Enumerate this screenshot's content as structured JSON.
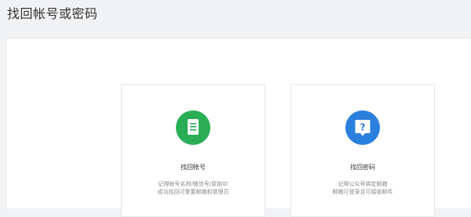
{
  "header": {
    "title": "找回帐号或密码"
  },
  "cards": [
    {
      "title": "找回帐号",
      "desc_line1": "记得帐号名称/微信号/原始ID",
      "desc_line2": "成功找回可重置邮箱和管理员",
      "icon": "document-icon",
      "color": "#2aae55"
    },
    {
      "title": "找回密码",
      "desc_line1": "记得公众号绑定邮箱",
      "desc_line2": "邮箱可登录且可接收邮件",
      "icon": "question-chat-icon",
      "color": "#2b7fdd"
    }
  ]
}
